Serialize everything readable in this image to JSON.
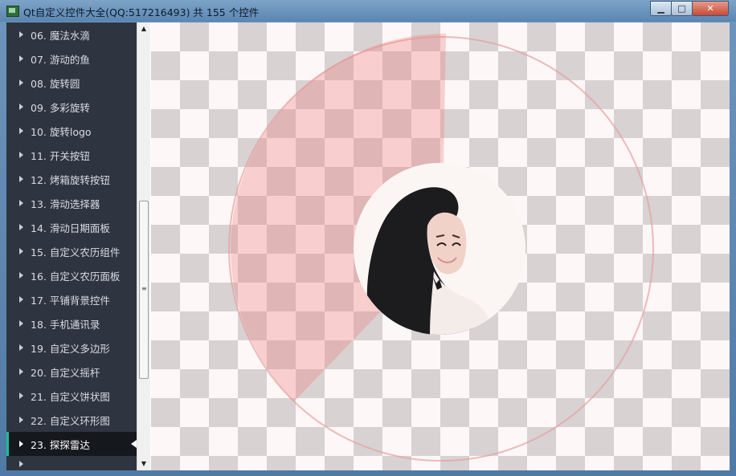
{
  "window": {
    "title": "Qt自定义控件大全(QQ:517216493) 共 155 个控件",
    "minimize_glyph": "▁",
    "maximize_glyph": "□",
    "close_glyph": "✕"
  },
  "sidebar": {
    "items": [
      {
        "label": "06. 魔法水滴"
      },
      {
        "label": "07. 游动的鱼"
      },
      {
        "label": "08. 旋转圆"
      },
      {
        "label": "09. 多彩旋转"
      },
      {
        "label": "10. 旋转logo"
      },
      {
        "label": "11. 开关按钮"
      },
      {
        "label": "12. 烤箱旋转按钮"
      },
      {
        "label": "13. 滑动选择器"
      },
      {
        "label": "14. 滑动日期面板"
      },
      {
        "label": "15. 自定义农历组件"
      },
      {
        "label": "16. 自定义农历面板"
      },
      {
        "label": "17. 平铺背景控件"
      },
      {
        "label": "18. 手机通讯录"
      },
      {
        "label": "19. 自定义多边形"
      },
      {
        "label": "20. 自定义摇杆"
      },
      {
        "label": "21. 自定义饼状图"
      },
      {
        "label": "22. 自定义环形图"
      },
      {
        "label": "23. 探探雷达"
      }
    ],
    "active_index": 17,
    "active_accent": "#1abc9c",
    "background": "#2f3540"
  },
  "scrollbar": {
    "up_glyph": "▲",
    "down_glyph": "▼",
    "grip_glyph": "≡"
  },
  "radar": {
    "sweep_color": "#f08080",
    "ring_color": "#e6a0a0"
  },
  "icons": {
    "list_item": "triangle-right-icon",
    "selection": "triangle-left-icon"
  }
}
